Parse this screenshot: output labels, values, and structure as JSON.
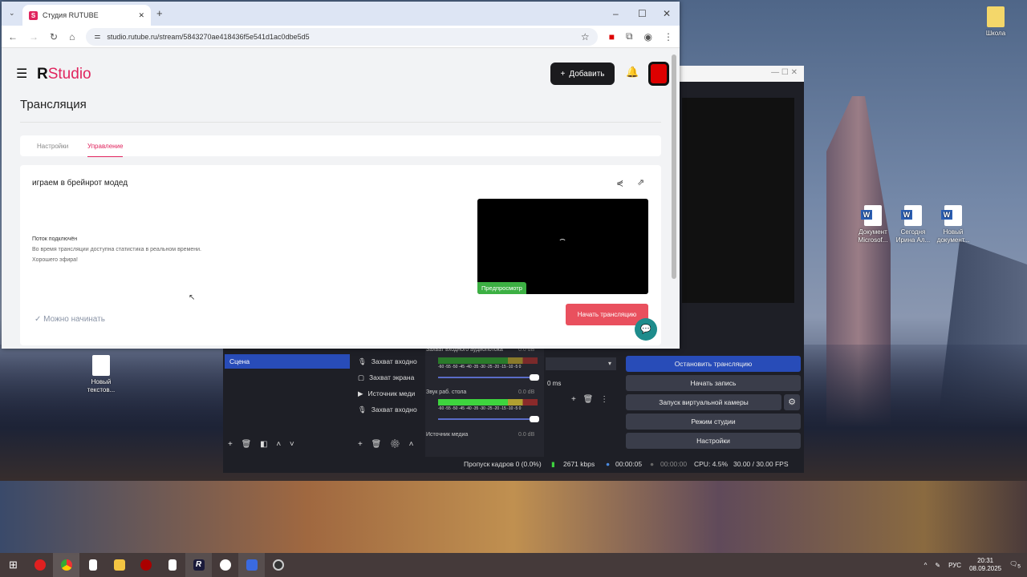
{
  "browser": {
    "tab_title": "Студия RUTUBE",
    "url": "studio.rutube.ru/stream/5843270ae418436f5e541d1ac0dbe5d5"
  },
  "studio": {
    "logo_r": "R",
    "logo_text": "Studio",
    "add_label": "Добавить",
    "page_title": "Трансляция",
    "tabs": [
      {
        "label": "Настройки"
      },
      {
        "label": "Управление"
      }
    ],
    "stream_title": "играем в брейнрот модед",
    "status_title": "Поток подключён",
    "status_line1": "Во время трансляции доступна статистика в реальном времени.",
    "status_line2": "Хорошего эфира!",
    "preview_label": "Предпросмотр",
    "ready_label": "Можно начинать",
    "start_label": "Начать трансляцию"
  },
  "obs": {
    "scene": "Сцена",
    "sources": [
      {
        "label": "Захват входно"
      },
      {
        "label": "Захват экрана"
      },
      {
        "label": "Источник меди"
      },
      {
        "label": "Захват входно"
      }
    ],
    "mixer": [
      {
        "name": "Захват входного аудиопотока",
        "db": "0.0 dB"
      },
      {
        "name": "Звук раб. стола",
        "db": "0.0 dB"
      },
      {
        "name": "Источник медиа",
        "db": "0.0 dB"
      }
    ],
    "meter_ticks": "-60 -55 -50 -45 -40 -35 -30 -25 -20 -15 -10 -5 0",
    "transition_duration": "0 ms",
    "controls": [
      "Остановить трансляцию",
      "Начать запись",
      "Запуск виртуальной камеры",
      "Режим студии",
      "Настройки"
    ],
    "status": {
      "dropped": "Пропуск кадров 0 (0.0%)",
      "bitrate": "2671 kbps",
      "stream_time": "00:00:05",
      "rec_time": "00:00:00",
      "cpu": "CPU: 4.5%",
      "fps": "30.00 / 30.00 FPS"
    }
  },
  "desktop": {
    "icons": [
      {
        "label": "Школа"
      },
      {
        "label": "Документ Microsof..."
      },
      {
        "label": "Сегодня Ирина Ал..."
      },
      {
        "label": "Новый документ..."
      },
      {
        "label": "Новый текстов..."
      }
    ]
  },
  "taskbar": {
    "lang": "РУС",
    "time": "20:31",
    "date": "08.09.2025",
    "notifications": "5"
  },
  "colors": {
    "accent": "#e0245e",
    "start": "#e9505e",
    "preview": "#3cb043",
    "obs_stop": "#284cb8"
  }
}
